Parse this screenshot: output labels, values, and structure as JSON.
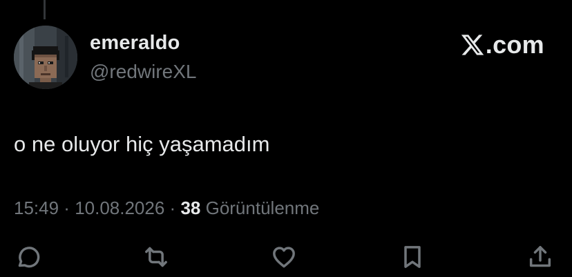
{
  "author": {
    "display_name": "emeraldo",
    "handle": "@redwireXL"
  },
  "brand": {
    "text": ".com",
    "icon": "x-logo-icon"
  },
  "tweet": {
    "text": "o ne oluyor hiç yaşamadım"
  },
  "meta": {
    "time": "15:49",
    "separator": " · ",
    "date": "10.08.2026",
    "views_count": "38",
    "views_label": "Görüntülenme"
  },
  "actions": [
    {
      "name": "reply",
      "icon": "reply-icon"
    },
    {
      "name": "retweet",
      "icon": "retweet-icon"
    },
    {
      "name": "like",
      "icon": "heart-icon"
    },
    {
      "name": "bookmark",
      "icon": "bookmark-icon"
    },
    {
      "name": "share",
      "icon": "share-icon"
    }
  ],
  "colors": {
    "background": "#000000",
    "text_primary": "#e7e9ea",
    "text_secondary": "#71767b"
  }
}
